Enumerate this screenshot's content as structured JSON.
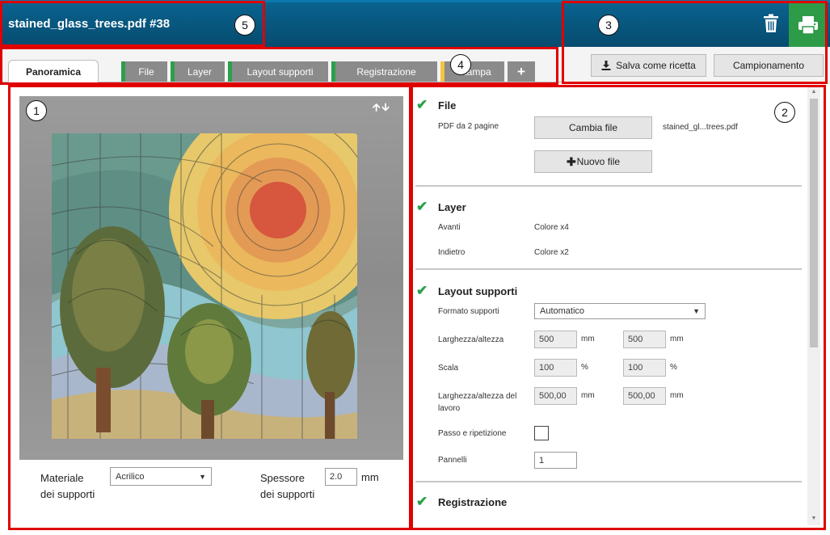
{
  "header": {
    "title": "stained_glass_trees.pdf #38",
    "trash_icon": "trash-icon",
    "print_icon": "printer-icon",
    "print_color": "#2d9b48"
  },
  "tabs": {
    "overview": "Panoramica",
    "items": [
      {
        "label": "File",
        "status_color": "#2ba04a"
      },
      {
        "label": "Layer",
        "status_color": "#2ba04a"
      },
      {
        "label": "Layout supporti",
        "status_color": "#2ba04a"
      },
      {
        "label": "Registrazione",
        "status_color": "#2ba04a"
      },
      {
        "label": "Stampa",
        "status_color": "#f4c542"
      }
    ],
    "add_label": "+"
  },
  "actions": {
    "save_recipe": "Salva come ricetta",
    "save_icon": "download-icon",
    "sampling": "Campionamento"
  },
  "preview": {
    "arrows_icon": "up-down-arrows-icon",
    "material_label": "Materiale dei supporti",
    "material_value": "Acrilico",
    "thickness_label": "Spessore dei supporti",
    "thickness_value": "2.0",
    "thickness_unit": "mm"
  },
  "sections": {
    "file": {
      "title": "File",
      "info": "PDF da 2 pagine",
      "change_button": "Cambia file",
      "new_button": "Nuovo file",
      "filename": "stained_gl...trees.pdf"
    },
    "layer": {
      "title": "Layer",
      "front_label": "Avanti",
      "front_value": "Colore x4",
      "back_label": "Indietro",
      "back_value": "Colore x2"
    },
    "layout": {
      "title": "Layout supporti",
      "format_label": "Formato supporti",
      "format_value": "Automatico",
      "size_label": "Larghezza/altezza",
      "width": "500",
      "height": "500",
      "size_unit": "mm",
      "scale_label": "Scala",
      "scale_x": "100",
      "scale_y": "100",
      "scale_unit": "%",
      "work_size_label": "Larghezza/altezza del lavoro",
      "work_width": "500,00",
      "work_height": "500,00",
      "work_unit": "mm",
      "step_repeat_label": "Passo e ripetizione",
      "panels_label": "Pannelli",
      "panels_value": "1"
    },
    "registration": {
      "title": "Registrazione"
    }
  },
  "callouts": [
    "1",
    "2",
    "3",
    "4",
    "5"
  ]
}
